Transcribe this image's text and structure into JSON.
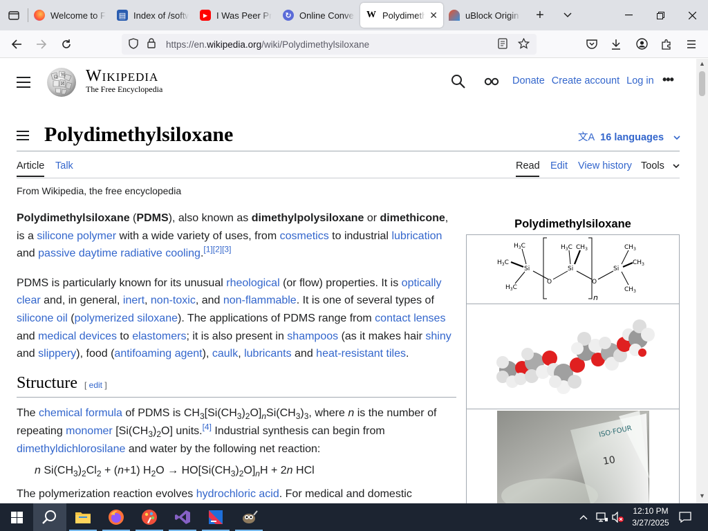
{
  "browser": {
    "tabs": [
      {
        "title": "Welcome to Firefox",
        "fav_color": "#ff7139"
      },
      {
        "title": "Index of /software",
        "fav_color": "#2a5db0"
      },
      {
        "title": "I Was Peer Pressured",
        "fav_color": "#ff0000"
      },
      {
        "title": "Online Converter",
        "fav_color": "#5b6bd8"
      },
      {
        "title": "Polydimethylsiloxane",
        "fav_color": "#000000",
        "active": true
      },
      {
        "title": "uBlock Origin",
        "fav_color": "#e5532e"
      }
    ],
    "url_prefix": "https://en.",
    "url_domain": "wikipedia.org",
    "url_path": "/wiki/Polydimethylsiloxane"
  },
  "wiki": {
    "wordmark": "Wikipedia",
    "tagline": "The Free Encyclopedia",
    "header_links": [
      "Donate",
      "Create account",
      "Log in"
    ],
    "title": "Polydimethylsiloxane",
    "languages": "16 languages",
    "tabs_left": [
      "Article",
      "Talk"
    ],
    "tabs_right": [
      "Read",
      "Edit",
      "View history",
      "Tools"
    ],
    "from": "From Wikipedia, the free encyclopedia",
    "section_structure": "Structure",
    "edit_label": "edit",
    "infobox_title": "Polydimethylsiloxane",
    "infobox_subscript": "n"
  },
  "taskbar": {
    "time": "12:10 PM",
    "date": "3/27/2025"
  }
}
